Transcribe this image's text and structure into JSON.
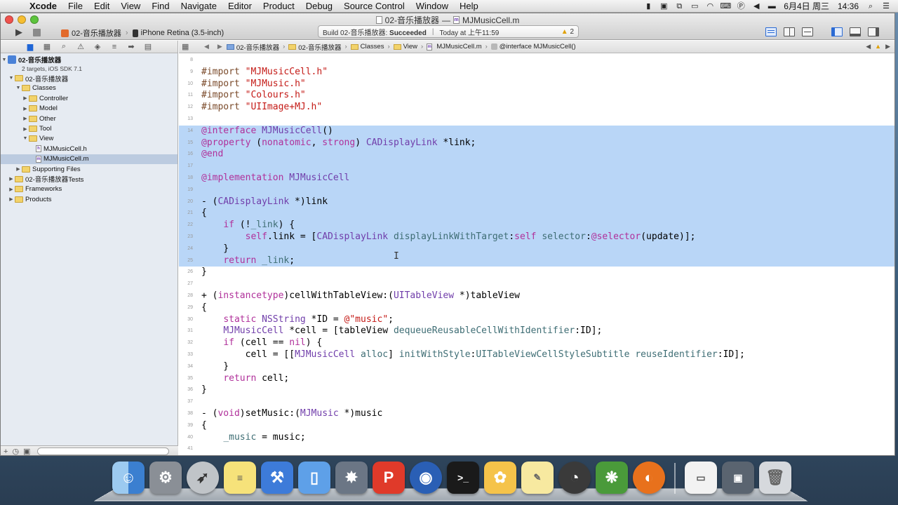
{
  "menubar": {
    "app": "Xcode",
    "items": [
      "File",
      "Edit",
      "View",
      "Find",
      "Navigate",
      "Editor",
      "Product",
      "Debug",
      "Source Control",
      "Window",
      "Help"
    ],
    "date": "6月4日 周三",
    "time": "14:36",
    "status_icons": [
      "evernote-icon",
      "screen-icon",
      "resize-icon",
      "display-icon",
      "wifi-icon",
      "input-method-icon",
      "parking-icon",
      "volume-icon",
      "battery-icon"
    ]
  },
  "window": {
    "title_project": "02-音乐播放器",
    "title_separator": "—",
    "title_file": "MJMusicCell.m",
    "scheme": "02-音乐播放器",
    "destination": "iPhone Retina (3.5-inch)",
    "activity_prefix": "Build 02-音乐播放器:",
    "activity_status": "Succeeded",
    "activity_time": "Today at 上午11:59",
    "warning_count": "2"
  },
  "navigator": {
    "project_name": "02-音乐播放器",
    "project_sub": "2 targets, iOS SDK 7.1",
    "items": [
      {
        "label": "02-音乐播放器",
        "level": 1,
        "kind": "folder",
        "open": true
      },
      {
        "label": "Classes",
        "level": 2,
        "kind": "folder",
        "open": true
      },
      {
        "label": "Controller",
        "level": 3,
        "kind": "folder",
        "open": false
      },
      {
        "label": "Model",
        "level": 3,
        "kind": "folder",
        "open": false
      },
      {
        "label": "Other",
        "level": 3,
        "kind": "folder",
        "open": false
      },
      {
        "label": "Tool",
        "level": 3,
        "kind": "folder",
        "open": false
      },
      {
        "label": "View",
        "level": 3,
        "kind": "folder",
        "open": true
      },
      {
        "label": "MJMusicCell.h",
        "level": 4,
        "kind": "file-h"
      },
      {
        "label": "MJMusicCell.m",
        "level": 4,
        "kind": "file-m",
        "selected": true
      },
      {
        "label": "Supporting Files",
        "level": 2,
        "kind": "folder",
        "open": false
      },
      {
        "label": "02-音乐播放器Tests",
        "level": 1,
        "kind": "folder",
        "open": false
      },
      {
        "label": "Frameworks",
        "level": 1,
        "kind": "folder",
        "open": false
      },
      {
        "label": "Products",
        "level": 1,
        "kind": "folder",
        "open": false
      }
    ]
  },
  "jumpbar": {
    "crumbs": [
      "02-音乐播放器",
      "02-音乐播放器",
      "Classes",
      "View",
      "MJMusicCell.m",
      "@interface MJMusicCell()"
    ]
  },
  "code": {
    "lines": [
      {
        "n": "8",
        "t": ""
      },
      {
        "n": "9",
        "t": "#import \"MJMusicCell.h\""
      },
      {
        "n": "10",
        "t": "#import \"MJMusic.h\""
      },
      {
        "n": "11",
        "t": "#import \"Colours.h\""
      },
      {
        "n": "12",
        "t": "#import \"UIImage+MJ.h\""
      },
      {
        "n": "13",
        "t": ""
      },
      {
        "n": "14",
        "t": "@interface MJMusicCell()",
        "sel": true
      },
      {
        "n": "15",
        "t": "@property (nonatomic, strong) CADisplayLink *link;",
        "sel": true
      },
      {
        "n": "16",
        "t": "@end",
        "sel": true
      },
      {
        "n": "17",
        "t": "",
        "sel": true
      },
      {
        "n": "18",
        "t": "@implementation MJMusicCell",
        "sel": true
      },
      {
        "n": "19",
        "t": "",
        "sel": true
      },
      {
        "n": "20",
        "t": "- (CADisplayLink *)link",
        "sel": true
      },
      {
        "n": "21",
        "t": "{",
        "sel": true
      },
      {
        "n": "22",
        "t": "    if (!_link) {",
        "sel": true
      },
      {
        "n": "23",
        "t": "        self.link = [CADisplayLink displayLinkWithTarget:self selector:@selector(update)];",
        "sel": true
      },
      {
        "n": "24",
        "t": "    }",
        "sel": true
      },
      {
        "n": "25",
        "t": "    return _link;",
        "sel": true
      },
      {
        "n": "26",
        "t": "}"
      },
      {
        "n": "27",
        "t": ""
      },
      {
        "n": "28",
        "t": "+ (instancetype)cellWithTableView:(UITableView *)tableView"
      },
      {
        "n": "29",
        "t": "{"
      },
      {
        "n": "30",
        "t": "    static NSString *ID = @\"music\";"
      },
      {
        "n": "31",
        "t": "    MJMusicCell *cell = [tableView dequeueReusableCellWithIdentifier:ID];"
      },
      {
        "n": "32",
        "t": "    if (cell == nil) {"
      },
      {
        "n": "33",
        "t": "        cell = [[MJMusicCell alloc] initWithStyle:UITableViewCellStyleSubtitle reuseIdentifier:ID];"
      },
      {
        "n": "34",
        "t": "    }"
      },
      {
        "n": "35",
        "t": "    return cell;"
      },
      {
        "n": "36",
        "t": "}"
      },
      {
        "n": "37",
        "t": ""
      },
      {
        "n": "38",
        "t": "- (void)setMusic:(MJMusic *)music"
      },
      {
        "n": "39",
        "t": "{"
      },
      {
        "n": "40",
        "t": "    _music = music;"
      },
      {
        "n": "41",
        "t": ""
      }
    ]
  },
  "dock": {
    "icons": [
      "finder-icon",
      "system-preferences-icon",
      "launchpad-icon",
      "stickies-icon",
      "xcode-icon",
      "simulator-icon",
      "photo-booth-icon",
      "wps-icon",
      "qq-icon",
      "terminal-icon",
      "paw-icon",
      "notes-icon",
      "instruments-icon",
      "vine-icon",
      "firefox-icon",
      "preview-window-icon",
      "screen-window-icon",
      "trash-icon"
    ],
    "colors": {
      "finder": "#4a90d9",
      "terminal": "#1a1a1a",
      "firefox": "#e8711c",
      "xcode": "#3d7bd9",
      "qq": "#2a5fb5"
    }
  },
  "colors": {
    "selection": "#b9d6f7",
    "keyword": "#b0309a",
    "string": "#c41a16",
    "accent": "#3f74c8"
  }
}
